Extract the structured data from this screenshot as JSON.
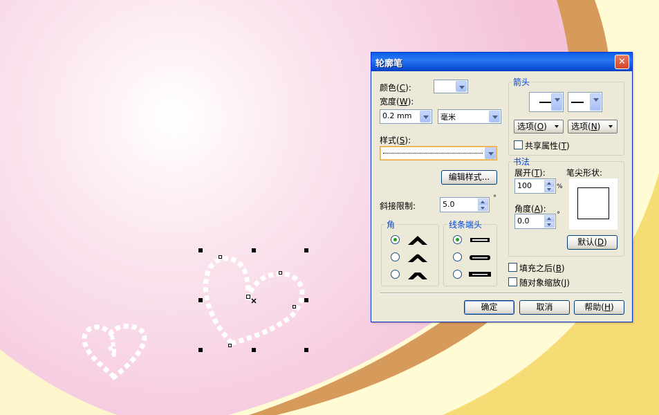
{
  "dialog": {
    "title": "轮廓笔",
    "close_label": "✕",
    "color": {
      "label": "颜色(",
      "key": "C",
      "suffix": "):"
    },
    "width": {
      "label": "宽度(",
      "key": "W",
      "suffix": "):",
      "value": "0.2 mm",
      "unit": "毫米"
    },
    "style": {
      "label": "样式(",
      "key": "S",
      "suffix": "):"
    },
    "edit_style_button": "编辑样式...",
    "miter_limit": {
      "label": "斜接限制:",
      "value": "5.0",
      "unit": "°"
    },
    "corners": {
      "title": "角",
      "selected": 0
    },
    "line_caps": {
      "title": "线条端头",
      "selected": 0
    },
    "arrows": {
      "title": "箭头",
      "left_option": {
        "label": "选项(",
        "key": "O",
        "suffix": ")"
      },
      "right_option": {
        "label": "选项(",
        "key": "N",
        "suffix": ")"
      },
      "share_attr": {
        "label": "共享属性(",
        "key": "T",
        "suffix": ")",
        "checked": false
      }
    },
    "calligraphy": {
      "title": "书法",
      "stretch": {
        "label": "展开(",
        "key": "T",
        "suffix": "):",
        "value": "100",
        "unit": "%"
      },
      "angle": {
        "label": "角度(",
        "key": "A",
        "suffix": "):",
        "value": "0.0",
        "unit": "°"
      },
      "nib_shape_label": "笔尖形状:",
      "default_button": {
        "label": "默认(",
        "key": "D",
        "suffix": ")"
      }
    },
    "behind_fill": {
      "label": "填充之后(",
      "key": "B",
      "suffix": ")",
      "checked": false
    },
    "scale_with_object": {
      "label": "随对象缩放(",
      "key": "J",
      "suffix": ")",
      "checked": false
    },
    "ok_button": "确定",
    "cancel_button": "取消",
    "help_button": {
      "label": "帮助(",
      "key": "H",
      "suffix": ")"
    }
  },
  "colors": {
    "canvas_pink": "#f6cde1",
    "swoosh_brown": "#d69a5a",
    "swoosh_yellow": "#f6dc74",
    "accent_blue": "#0046d5"
  }
}
